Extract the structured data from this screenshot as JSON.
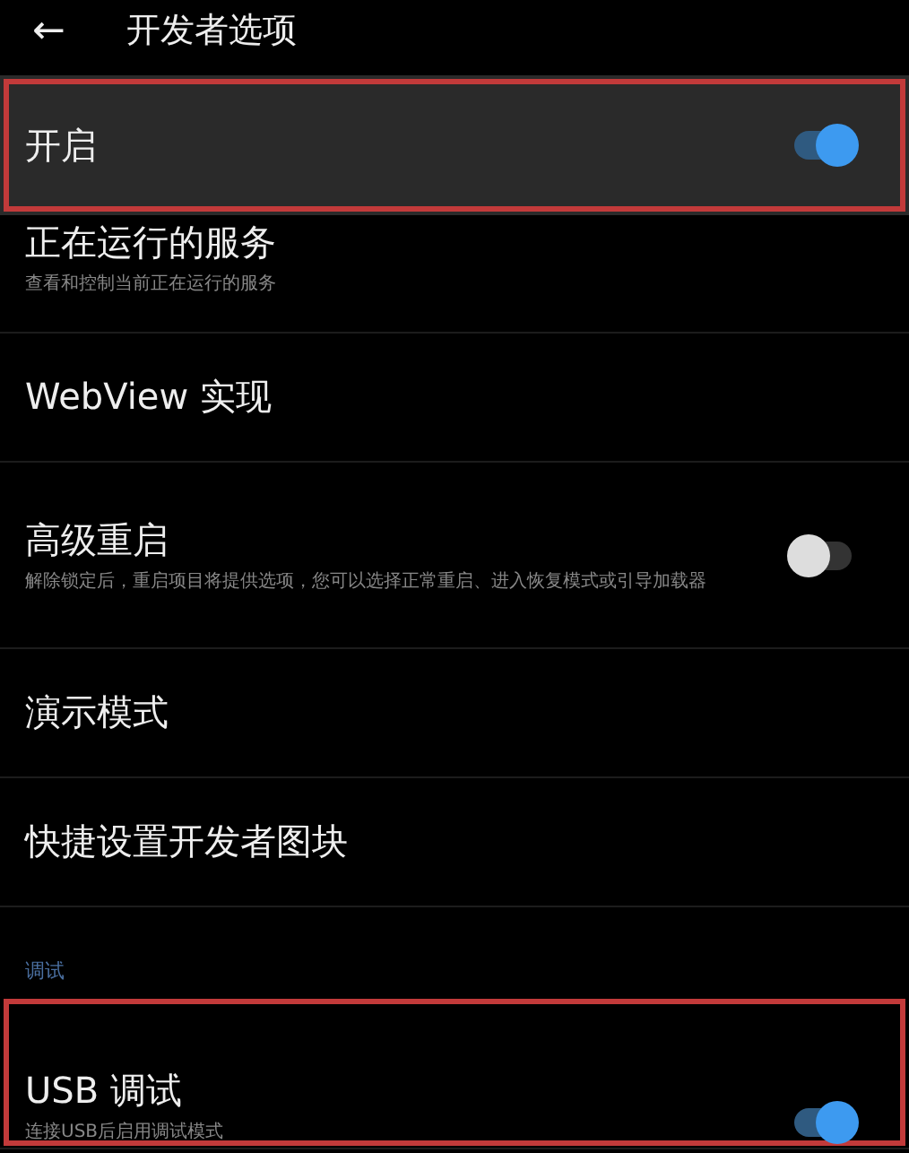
{
  "header": {
    "back": "←",
    "title": "开发者选项"
  },
  "rows": [
    {
      "kind": "master",
      "title": "开启",
      "switch": {
        "on": true
      },
      "highlighted": true
    },
    {
      "kind": "item",
      "title": "正在运行的服务",
      "subtitle": "查看和控制当前正在运行的服务",
      "highlighted": false
    },
    {
      "kind": "item",
      "title": "WebView 实现",
      "highlighted": false
    },
    {
      "kind": "item",
      "title": "高级重启",
      "subtitle": "解除锁定后，重启项目将提供选项，您可以选择正常重启、进入恢复模式或引导加载器",
      "switch": {
        "on": false
      },
      "highlighted": false
    },
    {
      "kind": "item",
      "title": "演示模式",
      "highlighted": false
    },
    {
      "kind": "item",
      "title": "快捷设置开发者图块",
      "highlighted": false
    },
    {
      "kind": "section",
      "title": "调试"
    },
    {
      "kind": "item",
      "title": "USB 调试",
      "subtitle": "连接USB后启用调试模式",
      "switch": {
        "on": true
      },
      "highlighted": true
    }
  ]
}
